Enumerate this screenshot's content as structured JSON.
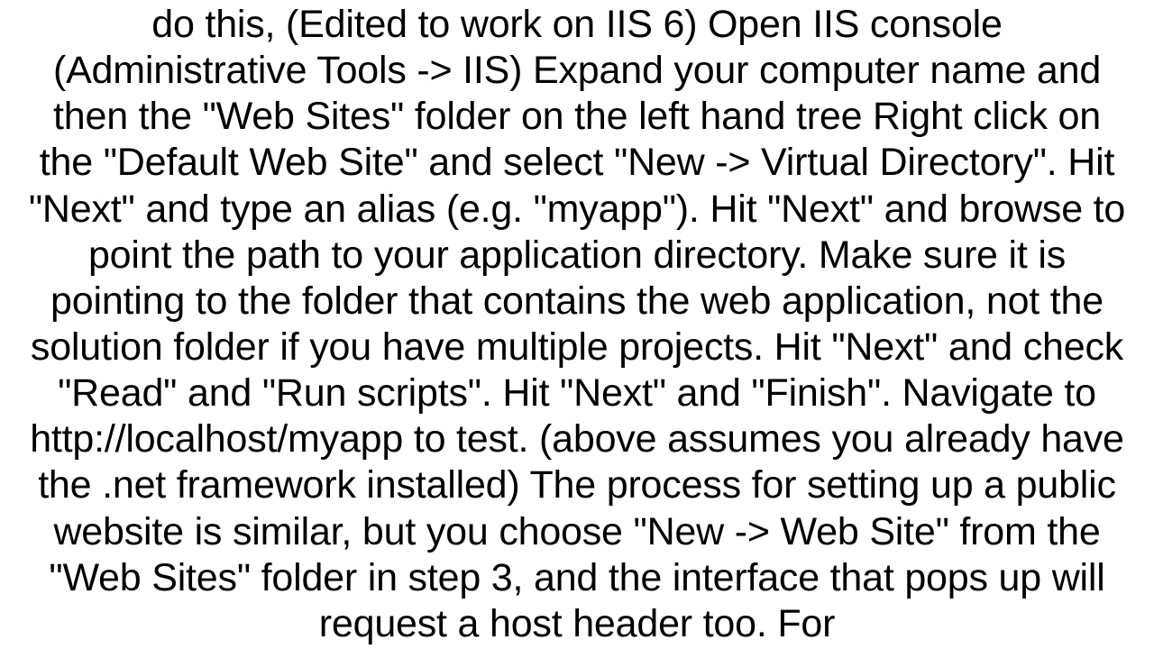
{
  "body_text": "do this,  (Edited to work on IIS 6)  Open IIS console (Administrative Tools -> IIS) Expand your computer name and then the \"Web Sites\" folder on the left hand tree Right click on the \"Default Web Site\" and select \"New -> Virtual Directory\". Hit \"Next\" and type an alias (e.g. \"myapp\"). Hit \"Next\" and browse to point the path to your application directory. Make sure it is pointing to the folder that contains the web application, not the solution folder if you have multiple projects. Hit \"Next\" and check \"Read\" and \"Run scripts\". Hit \"Next\" and \"Finish\". Navigate to http://localhost/myapp to test.  (above assumes you already have the .net framework installed) The process for setting up a public website is similar, but you choose \"New -> Web Site\" from the \"Web Sites\" folder in step 3, and the interface that pops up will request a host header too. For"
}
